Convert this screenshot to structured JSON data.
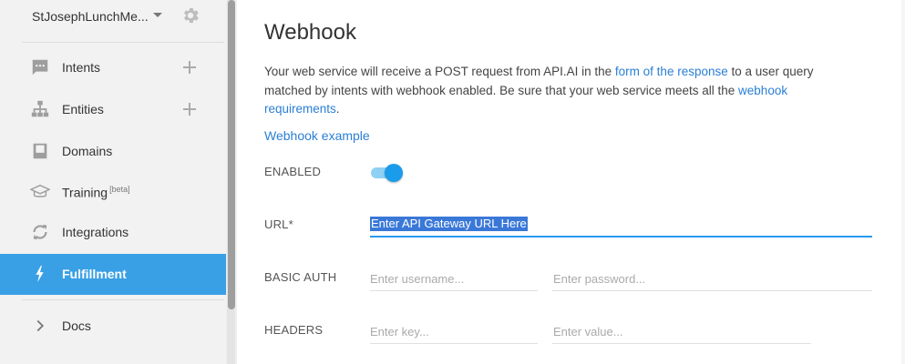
{
  "agent": {
    "name": "StJosephLunchMe..."
  },
  "sidebar": {
    "items": [
      {
        "label": "Intents",
        "has_add": true
      },
      {
        "label": "Entities",
        "has_add": true
      },
      {
        "label": "Domains"
      },
      {
        "label": "Training",
        "badge": "[beta]"
      },
      {
        "label": "Integrations"
      },
      {
        "label": "Fulfillment",
        "active": true
      },
      {
        "label": "Docs"
      }
    ]
  },
  "main": {
    "title": "Webhook",
    "desc": {
      "part1": "Your web service will receive a POST request from API.AI in the ",
      "link1": "form of the response",
      "part2": " to a user query matched by intents with webhook enabled. Be sure that your web service meets all the ",
      "link2": "webhook requirements",
      "part3": "."
    },
    "example_link": "Webhook example",
    "enabled_label": "ENABLED",
    "enabled": true,
    "url_label": "URL*",
    "url_value": "Enter API Gateway URL Here",
    "basic_auth_label": "BASIC AUTH",
    "username_placeholder": "Enter username...",
    "password_placeholder": "Enter password...",
    "headers_label": "HEADERS",
    "key_placeholder": "Enter key...",
    "value_placeholder": "Enter value..."
  },
  "colors": {
    "accent": "#39a0e6",
    "link": "#2a7fd4",
    "toggle": "#1a9ceb"
  }
}
